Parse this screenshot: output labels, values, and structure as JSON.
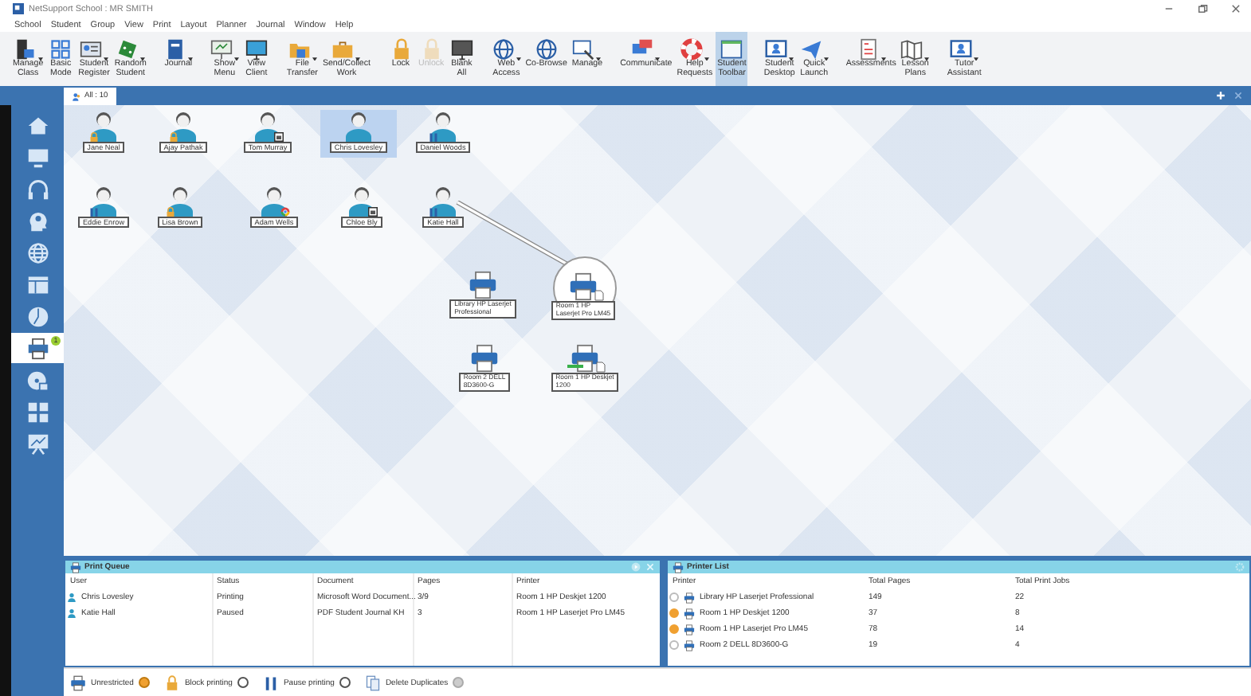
{
  "window": {
    "title": "NetSupport School : MR SMITH"
  },
  "menu": [
    "School",
    "Student",
    "Group",
    "View",
    "Print",
    "Layout",
    "Planner",
    "Journal",
    "Window",
    "Help"
  ],
  "toolbar": [
    [
      {
        "label": "Manage\nClass",
        "dropdown": true,
        "disabled": false,
        "selected": false
      },
      {
        "label": "Basic\nMode",
        "dropdown": false,
        "disabled": false,
        "selected": false
      },
      {
        "label": "Student\nRegister",
        "dropdown": true,
        "disabled": false,
        "selected": false
      },
      {
        "label": "Random\nStudent",
        "dropdown": true,
        "disabled": false,
        "selected": false
      }
    ],
    [
      {
        "label": "Journal",
        "dropdown": true,
        "disabled": false,
        "selected": false
      }
    ],
    [
      {
        "label": "Show\nMenu",
        "dropdown": true,
        "disabled": false,
        "selected": false
      },
      {
        "label": "View\nClient",
        "dropdown": false,
        "disabled": false,
        "selected": false
      }
    ],
    [
      {
        "label": "File\nTransfer",
        "dropdown": true,
        "disabled": false,
        "selected": false
      },
      {
        "label": "Send/Collect\nWork",
        "dropdown": true,
        "disabled": false,
        "selected": false
      }
    ],
    [
      {
        "label": "Lock",
        "dropdown": false,
        "disabled": false,
        "selected": false
      },
      {
        "label": "Unlock",
        "dropdown": false,
        "disabled": true,
        "selected": false
      },
      {
        "label": "Blank\nAll",
        "dropdown": false,
        "disabled": false,
        "selected": false
      }
    ],
    [
      {
        "label": "Web\nAccess",
        "dropdown": true,
        "disabled": false,
        "selected": false
      },
      {
        "label": "Co-Browse",
        "dropdown": false,
        "disabled": false,
        "selected": false
      },
      {
        "label": "Manage",
        "dropdown": true,
        "disabled": false,
        "selected": false
      }
    ],
    [
      {
        "label": "Communicate",
        "dropdown": true,
        "disabled": false,
        "selected": false
      },
      {
        "label": "Help\nRequests",
        "dropdown": true,
        "disabled": false,
        "selected": false
      },
      {
        "label": "Student\nToolbar",
        "dropdown": false,
        "disabled": false,
        "selected": true
      }
    ],
    [
      {
        "label": "Student\nDesktop",
        "dropdown": true,
        "disabled": false,
        "selected": false
      },
      {
        "label": "Quick\nLaunch",
        "dropdown": true,
        "disabled": false,
        "selected": false
      }
    ],
    [
      {
        "label": "Assessments",
        "dropdown": true,
        "disabled": false,
        "selected": false
      },
      {
        "label": "Lesson\nPlans",
        "dropdown": true,
        "disabled": false,
        "selected": false
      }
    ],
    [
      {
        "label": "Tutor\nAssistant",
        "dropdown": true,
        "disabled": false,
        "selected": false
      }
    ]
  ],
  "tabs": [
    {
      "label": "All : 10",
      "selected": true
    }
  ],
  "sidebar": {
    "items": [
      {
        "selected": false
      },
      {
        "selected": false
      },
      {
        "selected": false
      },
      {
        "selected": false
      },
      {
        "selected": false
      },
      {
        "selected": false
      },
      {
        "selected": false
      },
      {
        "selected": true,
        "badge": "1"
      },
      {
        "selected": false
      },
      {
        "selected": false
      },
      {
        "selected": false
      }
    ]
  },
  "students": [
    {
      "name": "Jane Neal",
      "selected": false,
      "kind": "locked"
    },
    {
      "name": "Ajay Pathak",
      "selected": false,
      "kind": "locked"
    },
    {
      "name": "Tom Murray",
      "selected": false,
      "kind": "window"
    },
    {
      "name": "Chris Lovesley",
      "selected": true,
      "kind": "plain"
    },
    {
      "name": "Daniel Woods",
      "selected": false,
      "kind": "paused"
    },
    {
      "name": "Eddie Enrow",
      "selected": false,
      "kind": "paused"
    },
    {
      "name": "Lisa Brown",
      "selected": false,
      "kind": "locked"
    },
    {
      "name": "Adam Wells",
      "selected": false,
      "kind": "browser"
    },
    {
      "name": "Chloe Bly",
      "selected": false,
      "kind": "window"
    },
    {
      "name": "Katie Hall",
      "selected": false,
      "kind": "paused"
    }
  ],
  "printers": [
    {
      "label": "Library HP Laserjet\nProfessional",
      "selected": false,
      "queued": false,
      "printing": false
    },
    {
      "label": "Room 1 HP\nLaserjet Pro LM45",
      "selected": true,
      "queued": true,
      "printing": false
    },
    {
      "label": "Room 2 DELL\n8D3600-G",
      "selected": false,
      "queued": false,
      "printing": false
    },
    {
      "label": "Room 1 HP Deskjet\n1200",
      "selected": false,
      "queued": true,
      "printing": true
    }
  ],
  "print_queue": {
    "title": "Print Queue",
    "columns": [
      "User",
      "Status",
      "Document",
      "Pages",
      "Printer"
    ],
    "rows": [
      {
        "cells": [
          "Chris Lovesley",
          "Printing",
          "Microsoft Word Document...",
          "3/9",
          "Room 1 HP Deskjet 1200"
        ]
      },
      {
        "cells": [
          "Katie Hall",
          "Paused",
          "PDF Student Journal KH",
          "3",
          "Room 1 HP Laserjet Pro LM45"
        ]
      }
    ],
    "options": [
      {
        "label": "Unrestricted",
        "selected": true,
        "disabled": false
      },
      {
        "label": "Block printing",
        "selected": false,
        "disabled": false
      },
      {
        "label": "Pause printing",
        "selected": false,
        "disabled": false
      },
      {
        "label": "Delete Duplicates",
        "selected": false,
        "disabled": true
      }
    ]
  },
  "printer_list": {
    "title": "Printer List",
    "columns": [
      "Printer",
      "Total Pages",
      "Total Print Jobs"
    ],
    "rows": [
      {
        "active": false,
        "cells": [
          "Library HP Laserjet Professional",
          "149",
          "22"
        ]
      },
      {
        "active": true,
        "cells": [
          "Room 1 HP Deskjet 1200",
          "37",
          "8"
        ]
      },
      {
        "active": true,
        "cells": [
          "Room 1 HP Laserjet Pro LM45",
          "78",
          "14"
        ]
      },
      {
        "active": false,
        "cells": [
          "Room 2 DELL 8D3600-G",
          "19",
          "4"
        ]
      }
    ]
  }
}
